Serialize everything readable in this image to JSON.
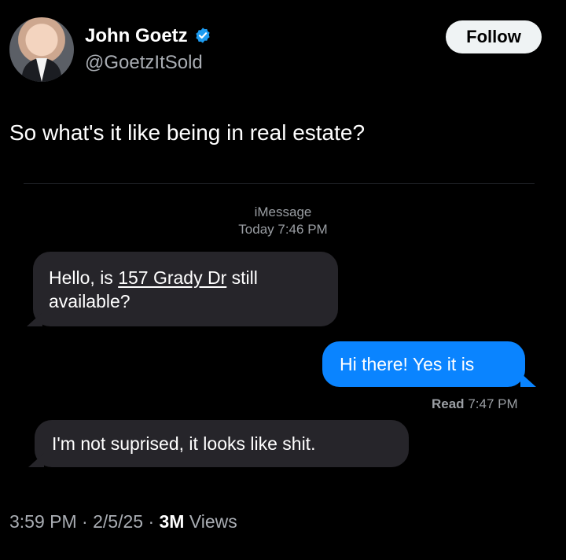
{
  "author": {
    "name": "John Goetz",
    "handle": "@GoetzItSold",
    "verified_icon": "verified-badge-icon",
    "verified_color": "#1d9bf0"
  },
  "follow_label": "Follow",
  "tweet_text": "So what's it like being in real estate?",
  "imessage": {
    "service": "iMessage",
    "timestamp": "Today 7:46 PM",
    "messages": [
      {
        "from": "them",
        "pre": "Hello, is ",
        "link": "157 Grady Dr",
        "post": " still available?"
      },
      {
        "from": "me",
        "text": "Hi there! Yes it is"
      },
      {
        "from": "them",
        "text": "I'm not suprised, it looks like shit."
      }
    ],
    "read_label": "Read",
    "read_time": "7:47 PM",
    "sent_color": "#0a84ff",
    "received_color": "#26252a"
  },
  "footer": {
    "time": "3:59 PM",
    "sep1": " · ",
    "date": "2/5/25",
    "sep2": " · ",
    "views_count": "3M",
    "views_label": " Views"
  }
}
